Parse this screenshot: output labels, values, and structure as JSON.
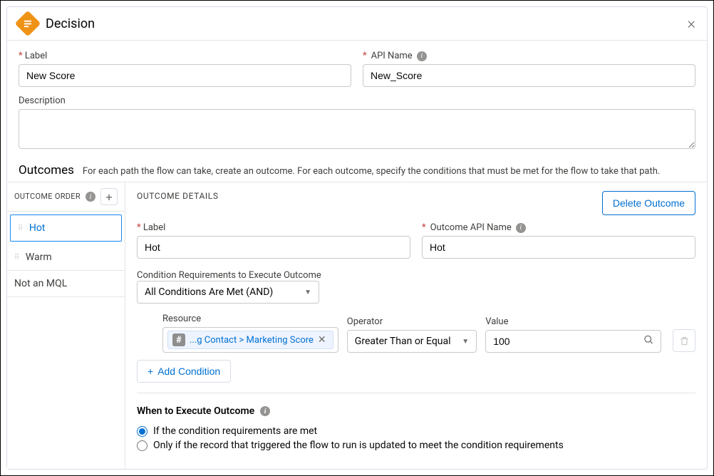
{
  "header": {
    "title": "Decision"
  },
  "fields": {
    "label_label": "Label",
    "label_value": "New Score",
    "api_label": "API Name",
    "api_value": "New_Score",
    "description_label": "Description",
    "description_value": ""
  },
  "outcomes_section": {
    "heading": "Outcomes",
    "sub": "For each path the flow can take, create an outcome. For each outcome, specify the conditions that must be met for the flow to take that path."
  },
  "sidebar": {
    "order_label": "OUTCOME ORDER",
    "items": [
      "Hot",
      "Warm",
      "Not an MQL"
    ]
  },
  "detail": {
    "heading": "OUTCOME DETAILS",
    "delete_btn": "Delete Outcome",
    "label_label": "Label",
    "label_value": "Hot",
    "api_label": "Outcome API Name",
    "api_value": "Hot",
    "cond_req_label": "Condition Requirements to Execute Outcome",
    "cond_req_value": "All Conditions Are Met (AND)",
    "cols": {
      "resource": "Resource",
      "operator": "Operator",
      "value": "Value"
    },
    "resource_text": "...g Contact > Marketing Score",
    "operator_value": "Greater Than or Equal",
    "value_value": "100",
    "add_condition": "Add Condition",
    "when_title": "When to Execute Outcome",
    "radio1": "If the condition requirements are met",
    "radio2": "Only if the record that triggered the flow to run is updated to meet the condition requirements"
  }
}
